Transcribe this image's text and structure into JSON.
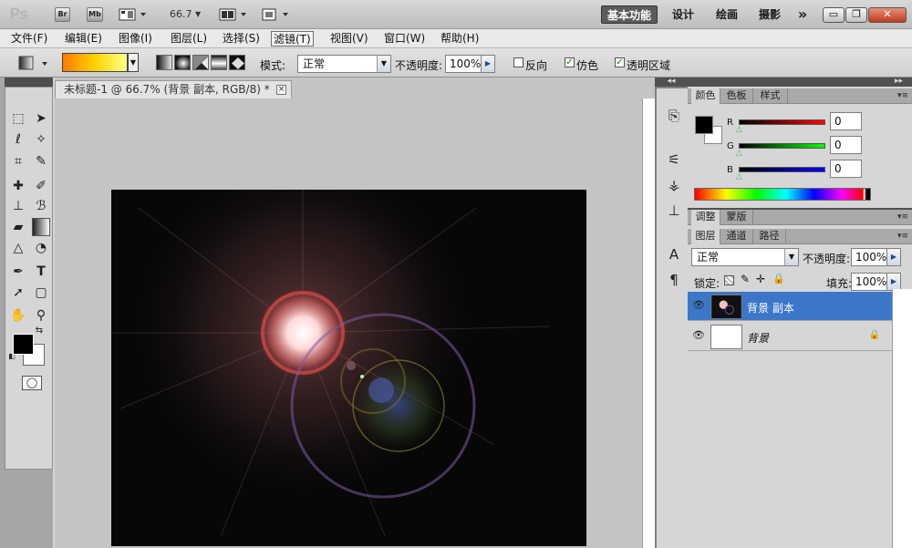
{
  "app": {
    "logo": "Ps",
    "bridge_label": "Br",
    "minibridge_label": "Mb",
    "zoom": "66.7",
    "workspaces": [
      "基本功能",
      "设计",
      "绘画",
      "摄影"
    ],
    "more": "»"
  },
  "menu": [
    "文件(F)",
    "编辑(E)",
    "图像(I)",
    "图层(L)",
    "选择(S)",
    "滤镜(T)",
    "视图(V)",
    "窗口(W)",
    "帮助(H)"
  ],
  "options": {
    "mode_label": "模式:",
    "mode_value": "正常",
    "opacity_label": "不透明度:",
    "opacity_value": "100%",
    "reverse_label": "反向",
    "dither_label": "仿色",
    "transparency_label": "透明区域",
    "gradient_colors": [
      "#ff7a00",
      "#ffd200",
      "#ffff88"
    ]
  },
  "document": {
    "title": "未标题-1 @ 66.7% (背景 副本, RGB/8) *",
    "close_glyph": "×"
  },
  "color_panel": {
    "tabs": [
      "颜色",
      "色板",
      "样式"
    ],
    "channels": [
      {
        "name": "R",
        "value": "0",
        "color": "#ff0000"
      },
      {
        "name": "G",
        "value": "0",
        "color": "#00ff00"
      },
      {
        "name": "B",
        "value": "0",
        "color": "#0000ff"
      }
    ],
    "foreground": "#000000",
    "background": "#ffffff"
  },
  "adjust_panel": {
    "tabs": [
      "调整",
      "蒙版"
    ]
  },
  "layers_panel": {
    "tabs": [
      "图层",
      "通道",
      "路径"
    ],
    "blend_mode": "正常",
    "opacity_label": "不透明度:",
    "opacity_value": "100%",
    "lock_label": "锁定:",
    "fill_label": "填充:",
    "fill_value": "100%",
    "layers": [
      {
        "name": "背景 副本",
        "selected": true
      },
      {
        "name": "背景",
        "selected": false
      }
    ]
  }
}
